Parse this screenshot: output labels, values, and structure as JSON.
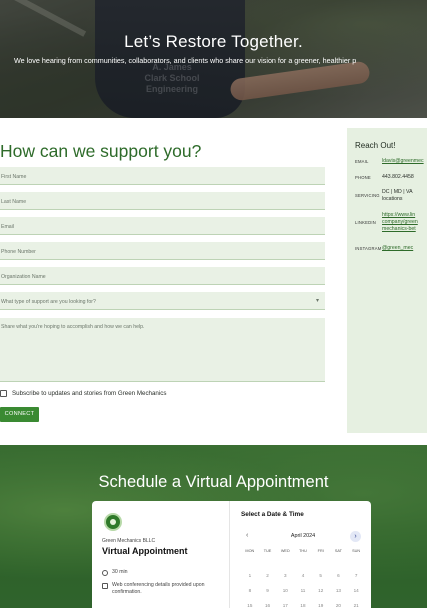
{
  "hero": {
    "title": "Let’s Restore Together.",
    "subtitle": "We love hearing from communities, collaborators, and clients who share our vision for a greener, healthier p",
    "shirt_text": "A. James\nClark School\nEngineering"
  },
  "form": {
    "title": "How can we support you?",
    "fields": [
      "First Name",
      "Last Name",
      "Email",
      "Phone Number",
      "Organization Name",
      "What type of support are you looking for?"
    ],
    "textarea_placeholder": "Share what you're hoping to accomplish and how we can help.",
    "subscribe_label": "Subscribe to updates and stories from Green Mechanics",
    "subscribe_checked": false,
    "connect_label": "CONNECT"
  },
  "reach": {
    "title": "Reach Out!",
    "email_label": "EMAIL",
    "email_value": "ldavis@greenmec",
    "phone_label": "PHONE",
    "phone_value": "443.802.4458",
    "servicing_label": "SERVICING",
    "servicing_value_1": "DC | MD | VA ",
    "servicing_value_2": "locations",
    "linkedin_label": "LINKEDIN",
    "linkedin_value_1": "https://www.lin",
    "linkedin_value_2": "company/green",
    "linkedin_value_3": "mechanics-bet",
    "instagram_label": "INSTAGRAM",
    "instagram_value": "@green_mec"
  },
  "schedule": {
    "title": "Schedule a Virtual Appointment",
    "org": "Green Mechanics BLLC",
    "appointment": "Virtual Appointment",
    "duration": "30 min",
    "conferencing": "Web conferencing details provided upon confirmation.",
    "calendar_title": "Select a Date & Time",
    "month": "April 2024",
    "prev": "‹",
    "next": "›",
    "days_of_week": [
      "MON",
      "TUE",
      "WED",
      "THU",
      "FRI",
      "SAT",
      "SUN"
    ],
    "weeks": [
      [
        "",
        "",
        "",
        "",
        "",
        "",
        ""
      ],
      [
        "1",
        "2",
        "3",
        "4",
        "5",
        "6",
        "7"
      ],
      [
        "8",
        "9",
        "10",
        "11",
        "12",
        "13",
        "14"
      ],
      [
        "15",
        "16",
        "17",
        "18",
        "19",
        "20",
        "21"
      ]
    ]
  },
  "colors": {
    "accent": "#2e6b2a",
    "button": "#3a8a32",
    "field_bg": "#e9f1e5",
    "panel_bg": "#e6f0e1"
  }
}
